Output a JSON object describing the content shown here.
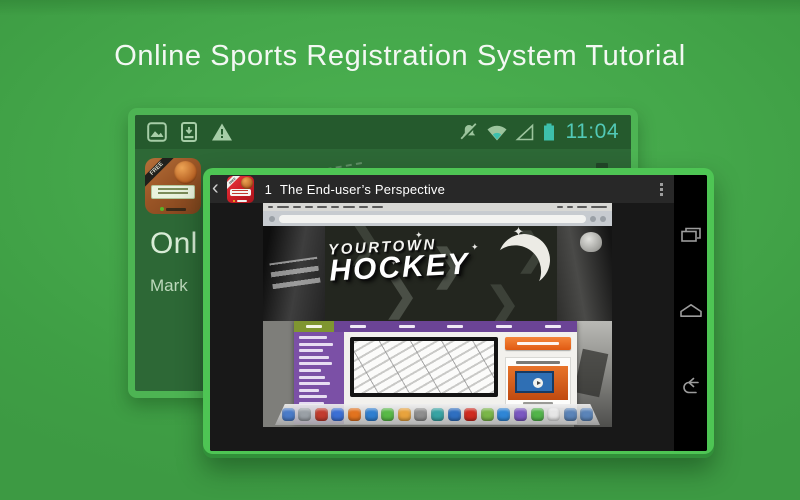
{
  "page": {
    "title": "Online Sports Registration System Tutorial"
  },
  "colors": {
    "background_green": "#3f9f45",
    "background_light": "#4cb251",
    "frame_green_front": "#4ec554",
    "frame_green_back": "#4db453",
    "statusbar_bg": "#255a2d",
    "screen_green": "#2d6836",
    "teal_accent": "#52c9b7",
    "action_bar_bg": "#282828",
    "nav_bar_bg": "#000000",
    "banner_bg": "#23261f",
    "site_purple": "#7b50a6",
    "site_navbar_purple": "#6b4496",
    "home_tab_olive": "#7f9630",
    "cta_orange": "#e05a12",
    "app_icon_red": "#cf1e27",
    "app_icon_brown": "#9a5526"
  },
  "back_phone": {
    "status_bar": {
      "time": "11:04",
      "left_icons": [
        "gallery-icon",
        "download-icon",
        "warning-icon"
      ],
      "right_icons": [
        "mute-icon",
        "wifi-icon",
        "signal-icon",
        "battery-icon"
      ]
    },
    "app_page": {
      "icon_ribbon": "FREE",
      "title_fragment": "Onl",
      "subtitle_fragment": "Mark"
    }
  },
  "front_phone": {
    "action_bar": {
      "back_glyph": "‹",
      "icon_ribbon": "FREE",
      "lesson_number": "1",
      "title": "The End-user’s Perspective",
      "overflow_icon": "kebab-menu"
    },
    "video_thumbnail": {
      "banner_title_line1": "YOURTOWN",
      "banner_title_line2": "HOCKEY",
      "pattern_glyph": "❯",
      "star_glyph": "✦"
    },
    "nav_buttons": [
      "recents",
      "home",
      "back"
    ],
    "dock_icon_colors": [
      "#4a7bc8",
      "#9aa0a6",
      "#c23b2e",
      "#3b6fd4",
      "#e2731f",
      "#2f7fd0",
      "#58b947",
      "#e8a33d",
      "#8e8e8e",
      "#37a3a3",
      "#2f6fc0",
      "#cf2b20",
      "#7ab648",
      "#2f86d6",
      "#7a57c1",
      "#52b44a",
      "#e6e6e6",
      "#5b84b8",
      "#5b84b8"
    ]
  }
}
